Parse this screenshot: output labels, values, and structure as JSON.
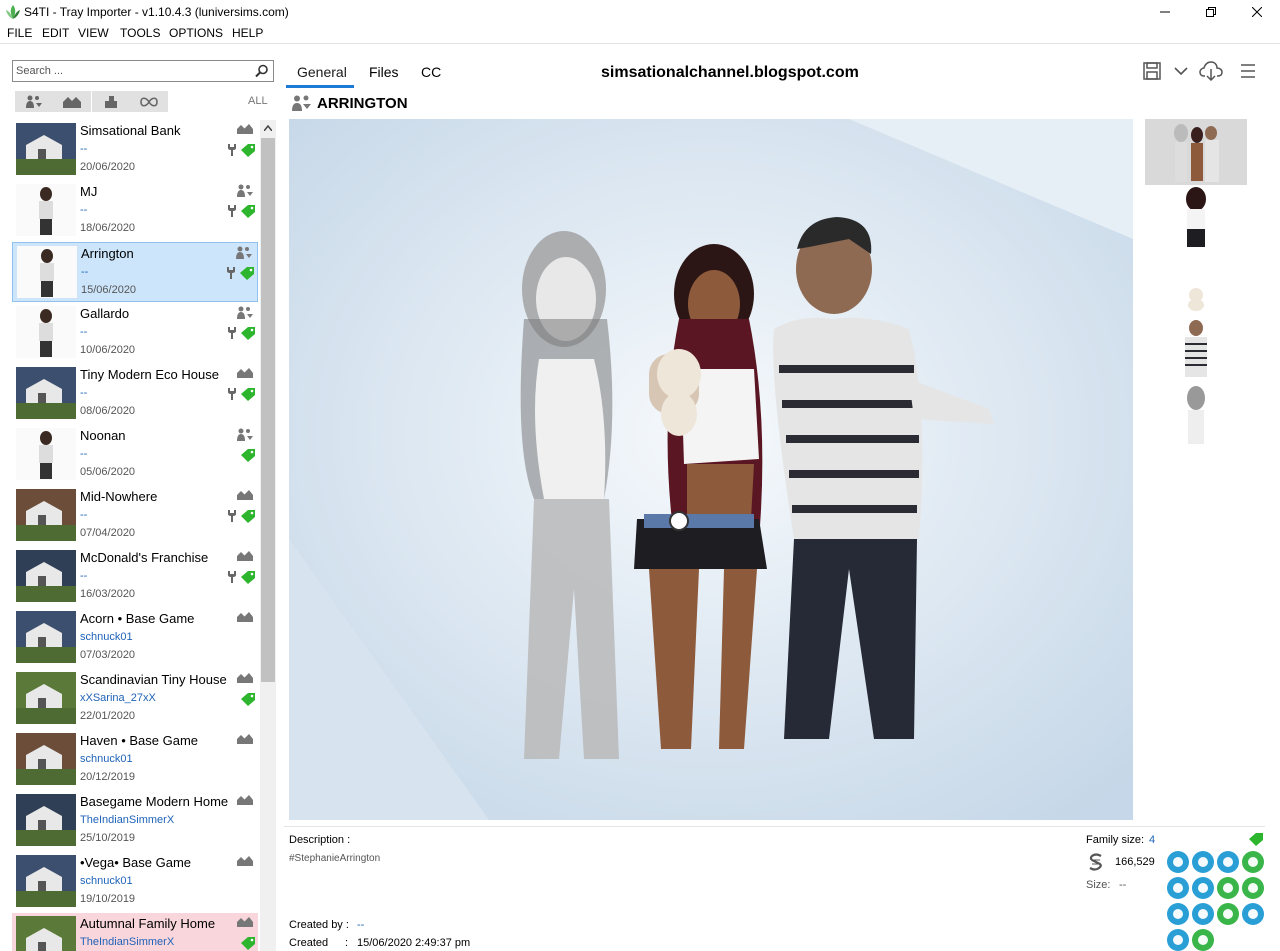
{
  "window": {
    "title": "S4TI - Tray Importer - v1.10.4.3  (luniversims.com)"
  },
  "menu": [
    "FILE",
    "EDIT",
    "VIEW",
    "TOOLS",
    "OPTIONS",
    "HELP"
  ],
  "search": {
    "placeholder": "Search ..."
  },
  "filters": {
    "all_label": "ALL",
    "buttons": [
      "households-filter",
      "lots-filter",
      "rooms-filter",
      "all-filter"
    ]
  },
  "items": [
    {
      "name": "Simsational Bank",
      "creator": "--",
      "date": "20/06/2020",
      "type": "lot",
      "tools": true,
      "cc": true
    },
    {
      "name": "MJ",
      "creator": "--",
      "date": "18/06/2020",
      "type": "household",
      "tools": true,
      "cc": true
    },
    {
      "name": "Arrington",
      "creator": "--",
      "date": "15/06/2020",
      "type": "household",
      "tools": true,
      "cc": true,
      "selected": true
    },
    {
      "name": "Gallardo",
      "creator": "--",
      "date": "10/06/2020",
      "type": "household",
      "tools": true,
      "cc": true
    },
    {
      "name": "Tiny Modern Eco House",
      "creator": "--",
      "date": "08/06/2020",
      "type": "lot",
      "tools": true,
      "cc": true
    },
    {
      "name": "Noonan",
      "creator": "--",
      "date": "05/06/2020",
      "type": "household",
      "tools": false,
      "cc": true
    },
    {
      "name": "Mid-Nowhere",
      "creator": "--",
      "date": "07/04/2020",
      "type": "lot",
      "tools": true,
      "cc": true
    },
    {
      "name": "McDonald's Franchise",
      "creator": "--",
      "date": "16/03/2020",
      "type": "lot",
      "tools": true,
      "cc": true
    },
    {
      "name": "Acorn • Base Game",
      "creator": "schnuck01",
      "date": "07/03/2020",
      "type": "lot",
      "tools": false,
      "cc": false
    },
    {
      "name": "Scandinavian Tiny House",
      "creator": "xXSarina_27xX",
      "date": "22/01/2020",
      "type": "lot",
      "tools": false,
      "cc": true
    },
    {
      "name": "Haven • Base Game",
      "creator": "schnuck01",
      "date": "20/12/2019",
      "type": "lot",
      "tools": false,
      "cc": false
    },
    {
      "name": "Basegame Modern Home",
      "creator": "TheIndianSimmerX",
      "date": "25/10/2019",
      "type": "lot",
      "tools": false,
      "cc": false
    },
    {
      "name": "•Vega• Base Game",
      "creator": "schnuck01",
      "date": "19/10/2019",
      "type": "lot",
      "tools": false,
      "cc": false
    },
    {
      "name": "Autumnal Family Home",
      "creator": "TheIndianSimmerX",
      "date": "",
      "type": "lot",
      "tools": false,
      "cc": true,
      "highlight": true
    }
  ],
  "tabs": [
    "General",
    "Files",
    "CC"
  ],
  "active_tab": "General",
  "site_label": "simsationalchannel.blogspot.com",
  "toolbar": {
    "icons": [
      "save-icon",
      "chevron-down-icon",
      "cloud-download-icon",
      "hamburger-menu-icon"
    ]
  },
  "detail": {
    "title": "ARRINGTON",
    "description_label": "Description :",
    "description": "#StephanieArrington",
    "created_by_label": "Created by :",
    "created_by": "--",
    "created_label": "Created",
    "created_sep": ":",
    "created": "15/06/2020 2:49:37 pm",
    "family_size_label": "Family size:",
    "family_size": "4",
    "simoleons": "166,529",
    "size_label": "Size:",
    "size": "--"
  },
  "colors": {
    "accent": "#1a7ad4",
    "selected_bg": "#cce5fb",
    "highlight_bg": "#f9d5dc",
    "cc_green": "#2db52d",
    "pack_blue": "#2a9fd6",
    "pack_green": "#39b54a"
  }
}
